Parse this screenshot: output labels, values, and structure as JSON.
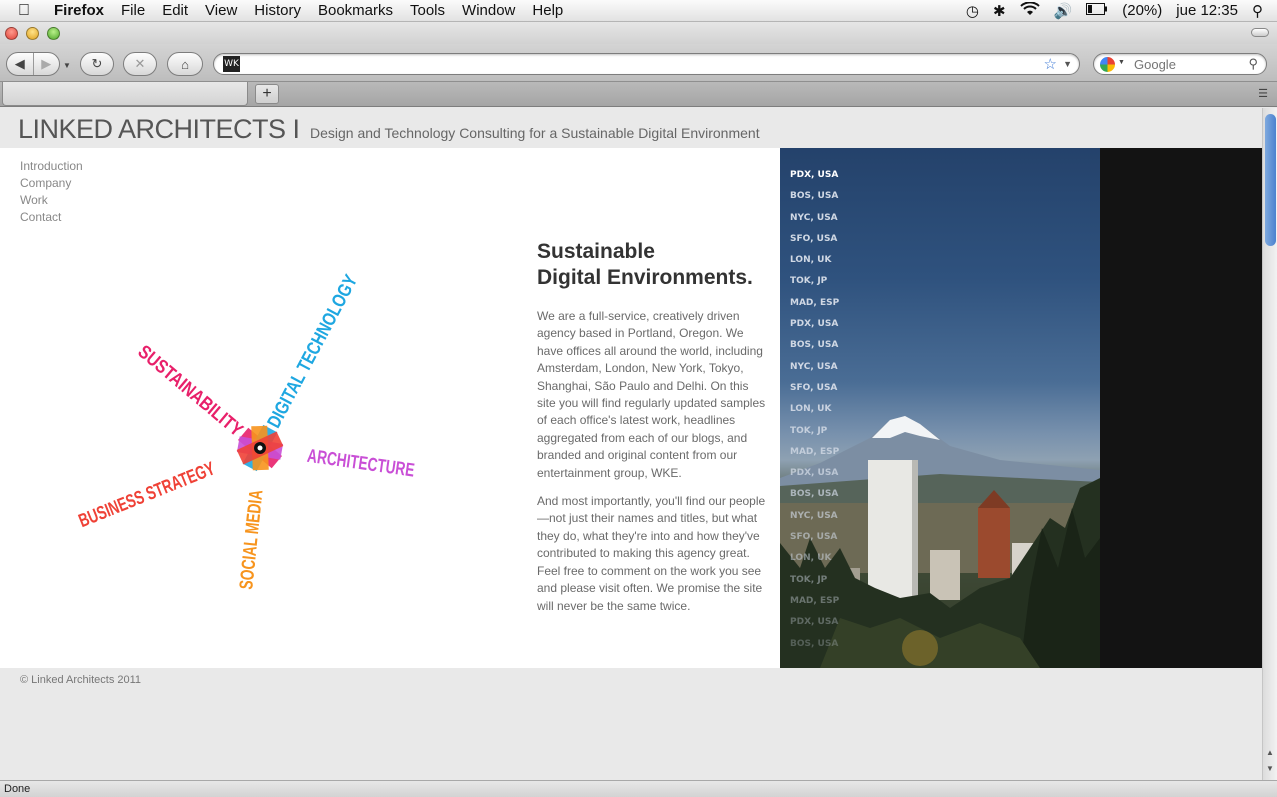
{
  "menubar": {
    "app": "Firefox",
    "items": [
      "File",
      "Edit",
      "View",
      "History",
      "Bookmarks",
      "Tools",
      "Window",
      "Help"
    ],
    "battery": "(20%)",
    "clock": "jue 12:35"
  },
  "toolbar": {
    "url": "",
    "favicon_text": "WK",
    "search_placeholder": "Google"
  },
  "site": {
    "title": "LINKED ARCHITECTS I",
    "tagline": "Design and Technology Consulting for a Sustainable Digital Environment",
    "nav": [
      "Introduction",
      "Company",
      "Work",
      "Contact"
    ],
    "logo_words": {
      "sustainability": "SUSTAINABILITY",
      "digital": "DIGITAL TECHNOLOGY",
      "architecture": "ARCHITECTURE",
      "business": "BUSINESS STRATEGY",
      "social": "SOCIAL MEDIA"
    },
    "headline_line1": "Sustainable",
    "headline_line2": "Digital Environments.",
    "paragraph1": "We are a full-service, creatively driven agency based in Portland, Oregon. We have offices all around the world, including Amsterdam, London, New York, Tokyo, Shanghai, São Paulo and Delhi. On this site you will find regularly updated samples of each office's latest work, headlines aggregated from each of our blogs, and branded and original content from our entertainment group, WKE.",
    "paragraph2": "And most importantly, you'll find our people—not just their names and titles, but what they do, what they're into and how they've contributed to making this agency great. Feel free to comment on the work you see and please visit often. We promise the site will never be the same twice.",
    "cities": [
      "PDX, USA",
      "BOS, USA",
      "NYC, USA",
      "SFO, USA",
      "LON, UK",
      "TOK, JP",
      "MAD, ESP",
      "PDX, USA",
      "BOS, USA",
      "NYC, USA",
      "SFO, USA",
      "LON, UK",
      "TOK, JP",
      "MAD, ESP",
      "PDX, USA",
      "BOS, USA",
      "NYC, USA",
      "SFO, USA",
      "LON, UK",
      "TOK, JP",
      "MAD, ESP",
      "PDX, USA",
      "BOS, USA"
    ],
    "footer": "© Linked Architects 2011"
  },
  "status": "Done",
  "colors": {
    "magenta": "#e8206a",
    "cyan": "#1ea7e1",
    "violet": "#c94fd6",
    "orange": "#f7941d",
    "red": "#ef4136"
  }
}
